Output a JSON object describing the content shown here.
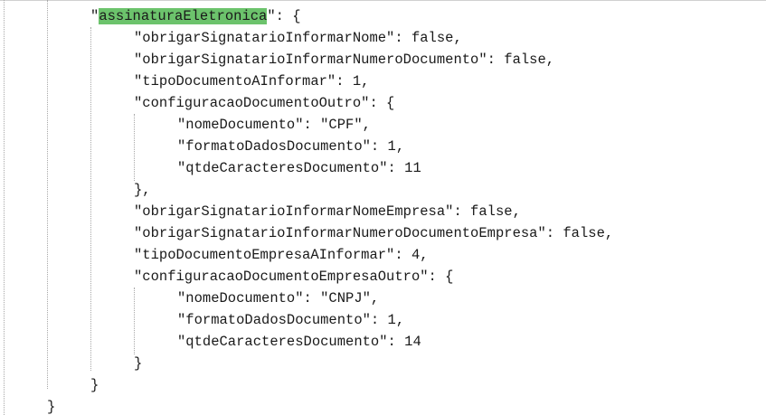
{
  "code": {
    "lines": [
      {
        "indent": 2,
        "segments": [
          {
            "text": "\""
          },
          {
            "text": "assinaturaEletronica",
            "highlight": true
          },
          {
            "text": "\": {"
          }
        ]
      },
      {
        "indent": 3,
        "segments": [
          {
            "text": "\"obrigarSignatarioInformarNome\": false,"
          }
        ]
      },
      {
        "indent": 3,
        "segments": [
          {
            "text": "\"obrigarSignatarioInformarNumeroDocumento\": false,"
          }
        ]
      },
      {
        "indent": 3,
        "segments": [
          {
            "text": "\"tipoDocumentoAInformar\": 1,"
          }
        ]
      },
      {
        "indent": 3,
        "segments": [
          {
            "text": "\"configuracaoDocumentoOutro\": {"
          }
        ]
      },
      {
        "indent": 4,
        "segments": [
          {
            "text": "\"nomeDocumento\": \"CPF\","
          }
        ]
      },
      {
        "indent": 4,
        "segments": [
          {
            "text": "\"formatoDadosDocumento\": 1,"
          }
        ]
      },
      {
        "indent": 4,
        "segments": [
          {
            "text": "\"qtdeCaracteresDocumento\": 11"
          }
        ]
      },
      {
        "indent": 3,
        "segments": [
          {
            "text": "},"
          }
        ]
      },
      {
        "indent": 3,
        "segments": [
          {
            "text": "\"obrigarSignatarioInformarNomeEmpresa\": false,"
          }
        ]
      },
      {
        "indent": 3,
        "segments": [
          {
            "text": "\"obrigarSignatarioInformarNumeroDocumentoEmpresa\": false,"
          }
        ]
      },
      {
        "indent": 3,
        "segments": [
          {
            "text": "\"tipoDocumentoEmpresaAInformar\": 4,"
          }
        ]
      },
      {
        "indent": 3,
        "segments": [
          {
            "text": "\"configuracaoDocumentoEmpresaOutro\": {"
          }
        ]
      },
      {
        "indent": 4,
        "segments": [
          {
            "text": "\"nomeDocumento\": \"CNPJ\","
          }
        ]
      },
      {
        "indent": 4,
        "segments": [
          {
            "text": "\"formatoDadosDocumento\": 1,"
          }
        ]
      },
      {
        "indent": 4,
        "segments": [
          {
            "text": "\"qtdeCaracteresDocumento\": 14"
          }
        ]
      },
      {
        "indent": 3,
        "segments": [
          {
            "text": "}"
          }
        ]
      },
      {
        "indent": 2,
        "segments": [
          {
            "text": "}"
          }
        ]
      },
      {
        "indent": 1,
        "segments": [
          {
            "text": "}"
          }
        ]
      }
    ],
    "highlight_color": "#6cc36c",
    "guide_color": "#a8a8a8",
    "text_color": "#1a1a1a"
  }
}
